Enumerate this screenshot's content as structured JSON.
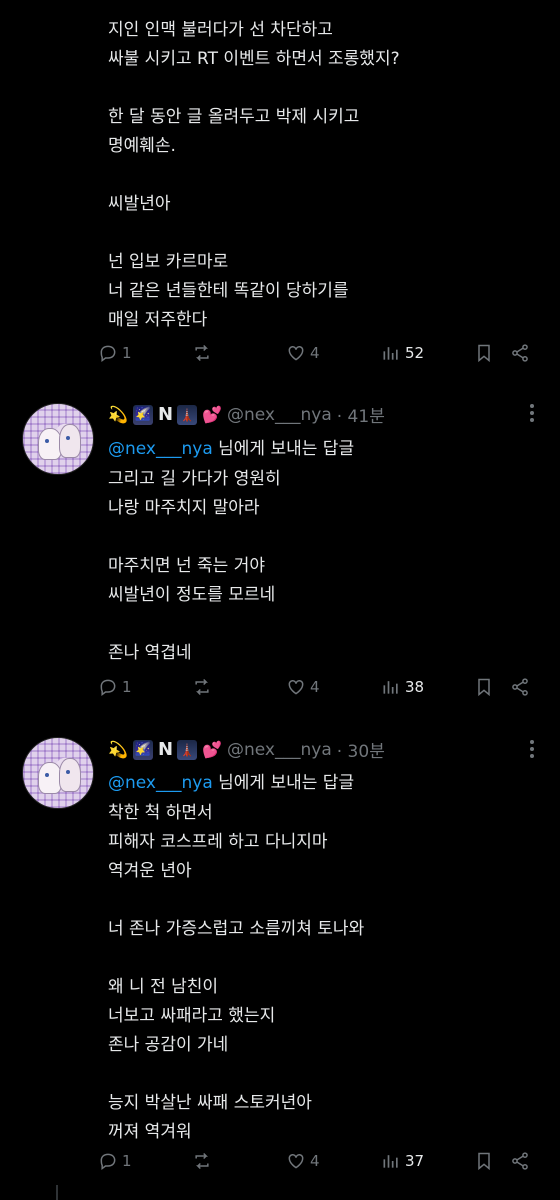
{
  "posts": [
    {
      "text": "지인 인맥 불러다가 선 차단하고\n싸불 시키고 RT 이벤트 하면서 조롱했지?\n\n한 달 동안 글 올려두고 박제 시키고\n명예훼손.\n\n씨발년아\n\n넌 입보 카르마로\n너 같은 년들한테 똑같이 당하기를\n매일 저주한다",
      "actions": {
        "replies": "1",
        "retweets": "",
        "likes": "4",
        "views": "52"
      }
    },
    {
      "name_emojis": [
        "💫",
        "🌠",
        "N",
        "🗼",
        "💕"
      ],
      "handle": "@nex___nya",
      "time": "· 41분",
      "reply_mention": "@nex___nya",
      "reply_suffix": " 님에게 보내는 답글",
      "text": "그리고 길 가다가 영원히\n나랑 마주치지 말아라\n\n마주치면 넌 죽는 거야\n씨발년이 정도를 모르네\n\n존나 역겹네",
      "actions": {
        "replies": "1",
        "retweets": "",
        "likes": "4",
        "views": "38"
      }
    },
    {
      "name_emojis": [
        "💫",
        "🌠",
        "N",
        "🗼",
        "💕"
      ],
      "handle": "@nex___nya",
      "time": "· 30분",
      "reply_mention": "@nex___nya",
      "reply_suffix": " 님에게 보내는 답글",
      "text": "착한 척 하면서\n피해자 코스프레 하고 다니지마\n역겨운 년아\n\n너 존나 가증스럽고 소름끼쳐 토나와\n\n왜 니 전 남친이\n너보고 싸패라고 했는지\n존나 공감이 가네\n\n능지 박살난 싸패 스토커년아\n꺼져 역겨워",
      "actions": {
        "replies": "1",
        "retweets": "",
        "likes": "4",
        "views": "37"
      }
    }
  ],
  "colors": {
    "background": "#000000",
    "text": "#e7e9ea",
    "muted": "#71767b",
    "link": "#1d9bf0"
  },
  "icons": [
    "reply-icon",
    "retweet-icon",
    "like-icon",
    "views-icon",
    "bookmark-icon",
    "share-icon",
    "more-icon"
  ]
}
